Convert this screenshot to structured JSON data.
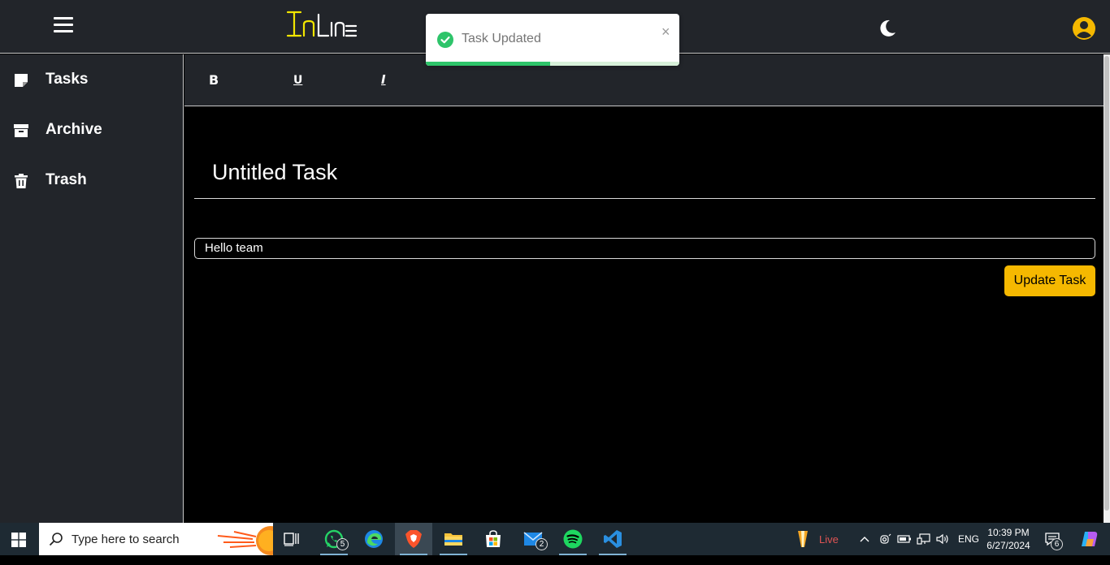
{
  "app": {
    "logo_text": "InLine",
    "theme_icon": "moon-icon",
    "account_icon": "user-circle-icon",
    "accent_color": "#f5b800"
  },
  "sidebar": {
    "items": [
      {
        "label": "Tasks",
        "icon": "note-icon"
      },
      {
        "label": "Archive",
        "icon": "archive-box-icon"
      },
      {
        "label": "Trash",
        "icon": "trash-icon"
      }
    ]
  },
  "toolbar": {
    "bold_label": "B",
    "underline_label": "U",
    "italic_label": "I"
  },
  "editor": {
    "title": "Untitled Task",
    "body_value": "Hello team",
    "update_label": "Update Task"
  },
  "toast": {
    "message": "Task Updated",
    "close_label": "×",
    "progress": 0.49,
    "status_color": "#2ec46a"
  },
  "taskbar": {
    "search_placeholder": "Type here to search",
    "whatsapp_badge": "5",
    "mail_badge": "2",
    "live_label": "Live",
    "language": "ENG",
    "time": "10:39 PM",
    "date": "6/27/2024",
    "notifications_badge": "6"
  }
}
